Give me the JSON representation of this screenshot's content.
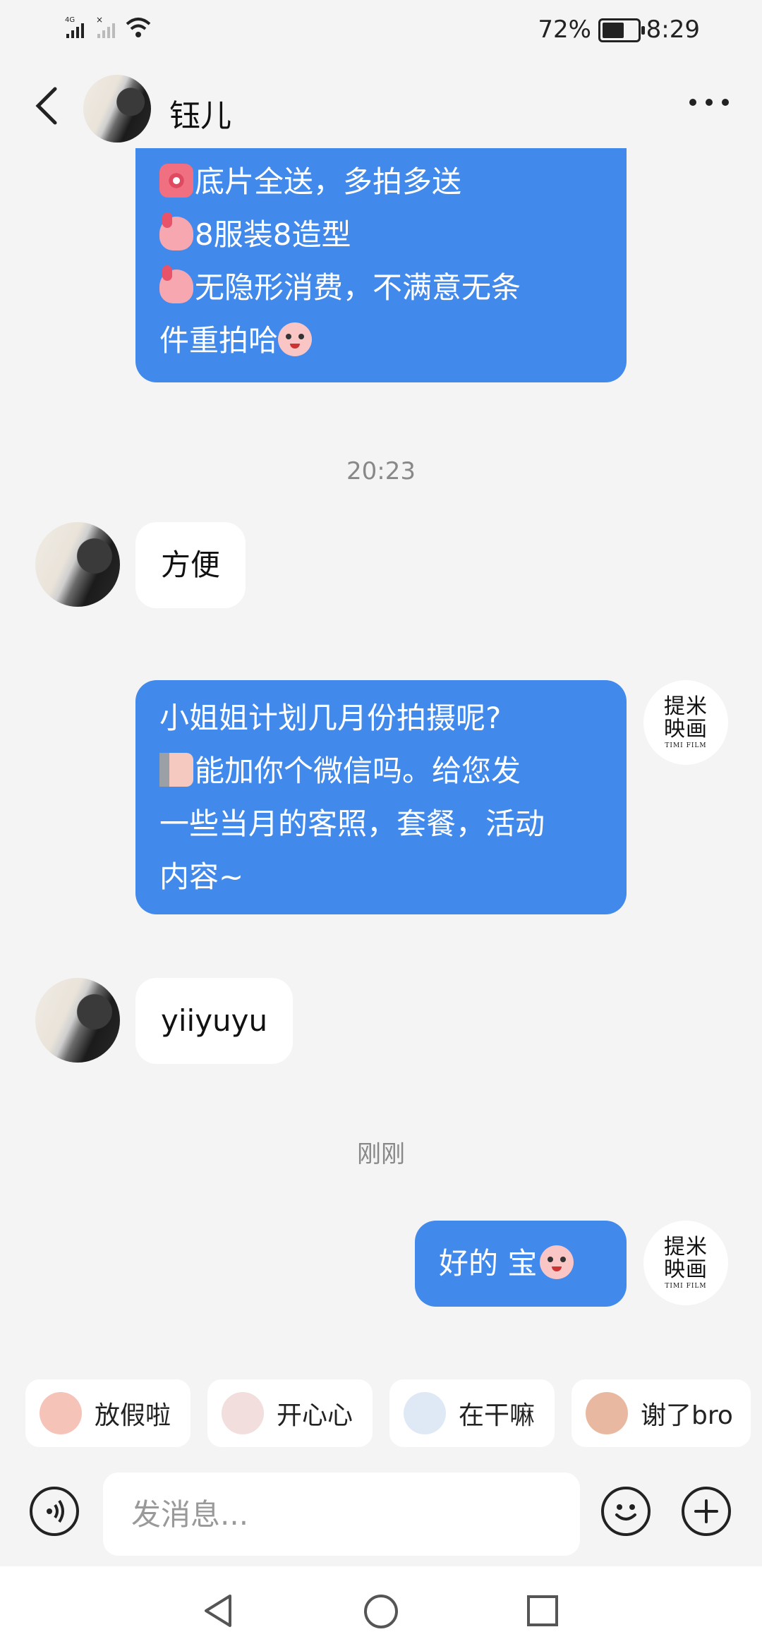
{
  "status_bar": {
    "network": "4G",
    "battery_pct": "72%",
    "battery_level": 0.72,
    "time": "8:29"
  },
  "header": {
    "contact_name": "钰儿"
  },
  "messages": [
    {
      "direction": "out",
      "lines": [
        "底片全送，多拍多送",
        "8服装8造型",
        "无隐形消费，不满意无条",
        "件重拍哈"
      ],
      "emojis": [
        "camera-emoji",
        "thumbs-up-emoji",
        "thumbs-up-emoji",
        "laughing-face-emoji"
      ]
    },
    {
      "type": "time",
      "text": "20:23"
    },
    {
      "direction": "in",
      "text": "方便"
    },
    {
      "direction": "out",
      "sender": "brand",
      "lines": [
        "小姐姐计划几月份拍摄呢?",
        "能加你个微信吗。给您发",
        "一些当月的客照，套餐，活动",
        "内容~"
      ],
      "emojis": [
        "peeking-emoji"
      ]
    },
    {
      "direction": "in",
      "text": "yiiyuyu"
    },
    {
      "type": "time",
      "text": "刚刚"
    },
    {
      "direction": "out",
      "sender": "brand",
      "text": "好的 宝",
      "emojis": [
        "blush-face-emoji"
      ]
    }
  ],
  "brand_avatar": {
    "line1": "提米",
    "line2": "映画",
    "line3": "TIMI FILM"
  },
  "quick_replies": [
    {
      "label": "放假啦",
      "icon": "sunglasses-sticker-icon"
    },
    {
      "label": "开心心",
      "icon": "heart-ghost-sticker-icon"
    },
    {
      "label": "在干嘛",
      "icon": "magnifier-sticker-icon"
    },
    {
      "label": "谢了bro",
      "icon": "thanks-sticker-icon"
    }
  ],
  "input": {
    "placeholder": "发消息..."
  },
  "colors": {
    "outgoing_bubble": "#4289ec",
    "incoming_bubble": "#ffffff",
    "background": "#f4f4f4"
  }
}
